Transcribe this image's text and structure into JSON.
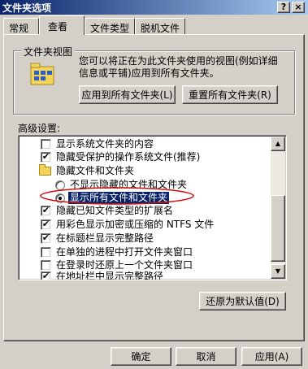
{
  "window": {
    "title": "文件夹选项",
    "help_glyph": "?",
    "close_glyph": "×"
  },
  "tabs": [
    {
      "label": "常规",
      "active": false
    },
    {
      "label": "查看",
      "active": true
    },
    {
      "label": "文件类型",
      "active": false
    },
    {
      "label": "脱机文件",
      "active": false
    }
  ],
  "folder_views": {
    "title": "文件夹视图",
    "description_line1": "您可以将正在为此文件夹使用的视图(例如详细",
    "description_line2": "信息或平铺)应用到所有文件夹。",
    "apply_all_label": "应用到所有文件夹(L)",
    "reset_all_label": "重置所有文件夹(R)"
  },
  "advanced": {
    "label": "高级设置:",
    "items": [
      {
        "type": "checkbox",
        "checked": false,
        "label": "显示系统文件夹的内容"
      },
      {
        "type": "checkbox",
        "checked": true,
        "label": "隐藏受保护的操作系统文件(推荐)"
      },
      {
        "type": "folder",
        "label": "隐藏文件和文件夹"
      },
      {
        "type": "radio",
        "checked": false,
        "label": "不显示隐藏的文件和文件夹"
      },
      {
        "type": "radio",
        "checked": true,
        "selected": true,
        "label": "显示所有文件和文件夹"
      },
      {
        "type": "checkbox",
        "checked": true,
        "label": "隐藏已知文件类型的扩展名"
      },
      {
        "type": "checkbox",
        "checked": true,
        "label": "用彩色显示加密或压缩的 NTFS 文件"
      },
      {
        "type": "checkbox",
        "checked": true,
        "label": "在标题栏显示完整路径"
      },
      {
        "type": "checkbox",
        "checked": false,
        "label": "在单独的进程中打开文件夹窗口"
      },
      {
        "type": "checkbox",
        "checked": false,
        "label": "在登录时还原上一个文件夹窗口"
      },
      {
        "type": "checkbox",
        "checked": true,
        "label": "在地址栏中显示完整路径"
      }
    ],
    "restore_defaults_label": "还原为默认值(D)"
  },
  "footer": {
    "ok_label": "确定",
    "cancel_label": "取消",
    "apply_label": "应用(A)"
  },
  "colors": {
    "selection": "#0a246a",
    "annotation_ellipse": "#cc1111",
    "title_gradient_start": "#0a246a",
    "title_gradient_end": "#a6caf0"
  },
  "icons": {
    "checkmark": "✔",
    "scroll_up": "▲",
    "scroll_down": "▼"
  }
}
